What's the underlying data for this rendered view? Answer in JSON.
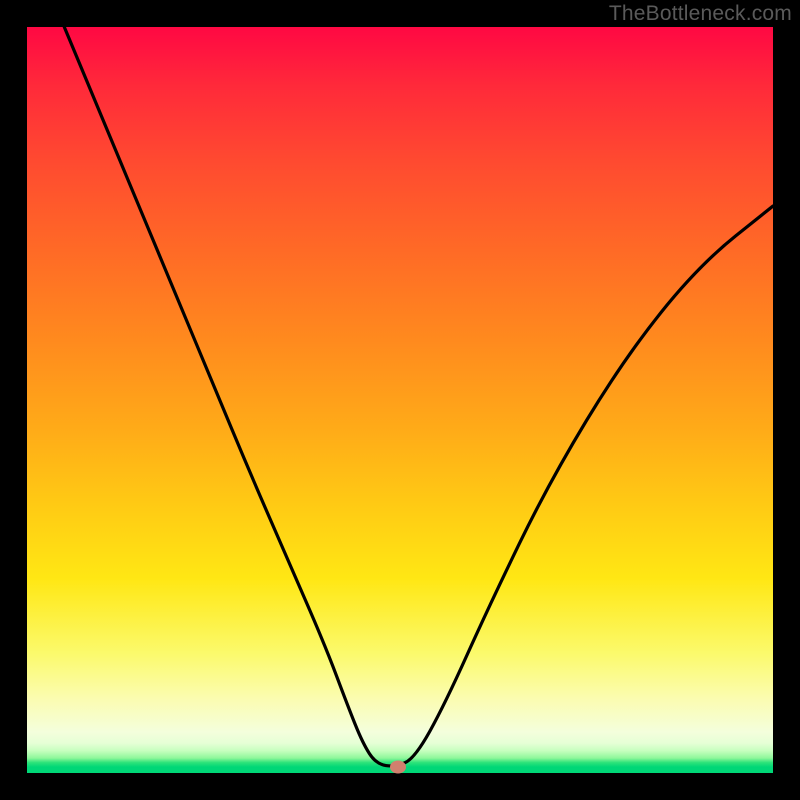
{
  "watermark": "TheBottleneck.com",
  "marker": {
    "x_frac": 0.497,
    "y_frac": 0.992
  },
  "chart_data": {
    "type": "line",
    "title": "",
    "xlabel": "",
    "ylabel": "",
    "xlim": [
      0,
      1
    ],
    "ylim": [
      0,
      1
    ],
    "series": [
      {
        "name": "bottleneck-curve",
        "x": [
          0.05,
          0.1,
          0.15,
          0.2,
          0.25,
          0.3,
          0.35,
          0.4,
          0.43,
          0.45,
          0.468,
          0.494,
          0.52,
          0.56,
          0.62,
          0.7,
          0.8,
          0.9,
          1.0
        ],
        "y": [
          1.0,
          0.88,
          0.76,
          0.64,
          0.52,
          0.4,
          0.285,
          0.17,
          0.09,
          0.04,
          0.012,
          0.008,
          0.02,
          0.092,
          0.225,
          0.39,
          0.555,
          0.68,
          0.76
        ]
      }
    ],
    "marker_point": {
      "x": 0.497,
      "y": 0.008
    },
    "background_gradient": {
      "top": "#ff0843",
      "mid": "#ffe714",
      "bottom": "#00d777"
    }
  }
}
